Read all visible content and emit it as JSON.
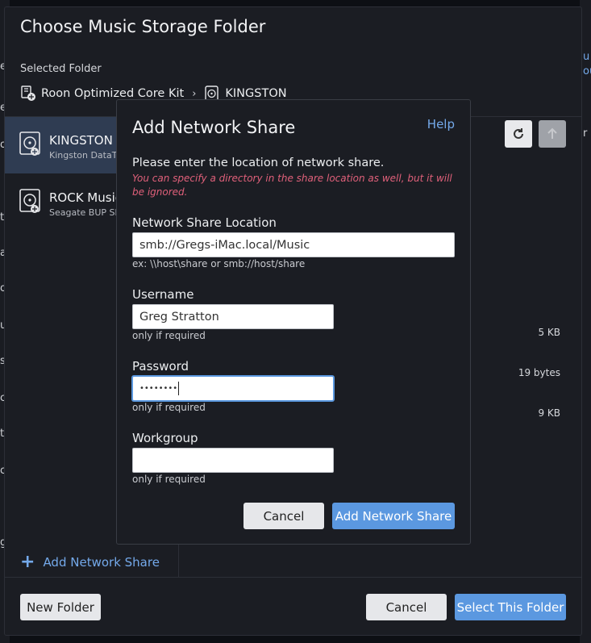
{
  "background": {
    "left_letters": [
      "e",
      "e",
      "o",
      "t",
      "a",
      "o",
      "u",
      "s",
      "c",
      "t",
      "c",
      "g"
    ],
    "right_letters": [
      "u",
      "ou",
      "r"
    ]
  },
  "dialog": {
    "title": "Choose Music Storage Folder",
    "selected_folder_label": "Selected Folder",
    "breadcrumb": [
      {
        "label": "Roon Optimized Core Kit",
        "icon": "core-kit-icon"
      },
      {
        "label": "KINGSTON",
        "icon": "drive-icon"
      }
    ],
    "drives": [
      {
        "name": "KINGSTON",
        "sub": "Kingston DataTra",
        "selected": true
      },
      {
        "name": "ROCK Music",
        "sub": "Seagate BUP Slim",
        "selected": false
      }
    ],
    "add_network_share_link": "Add Network Share",
    "file_sizes": [
      "5 KB",
      "19 bytes",
      "9 KB"
    ],
    "buttons": {
      "new_folder": "New Folder",
      "cancel": "Cancel",
      "select_this_folder": "Select This Folder"
    },
    "toolbar": {
      "refresh_icon": "refresh-icon",
      "up_icon": "arrow-up-icon"
    }
  },
  "modal": {
    "title": "Add Network Share",
    "help": "Help",
    "intro": "Please enter the location of network share.",
    "warning": "You can specify a directory in the share location as well, but it will be ignored.",
    "location": {
      "label": "Network Share Location",
      "value": "smb://Gregs-iMac.local/Music",
      "hint": "ex: \\\\host\\share or smb://host/share"
    },
    "username": {
      "label": "Username",
      "value": "Greg Stratton",
      "hint": "only if required"
    },
    "password": {
      "label": "Password",
      "value": "••••••••",
      "hint": "only if required"
    },
    "workgroup": {
      "label": "Workgroup",
      "value": "",
      "hint": "only if required"
    },
    "cancel": "Cancel",
    "submit": "Add Network Share"
  }
}
